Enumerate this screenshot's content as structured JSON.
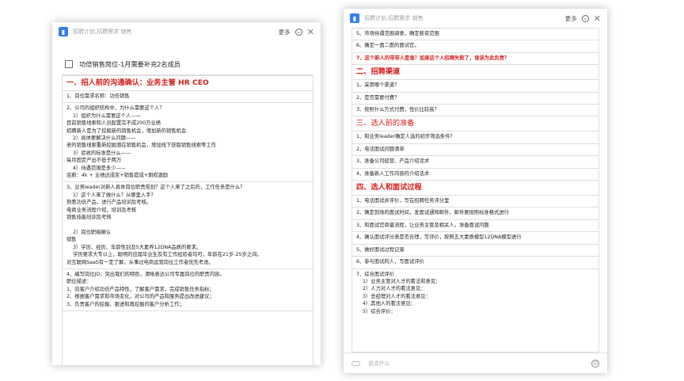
{
  "left": {
    "header": {
      "title": "招聘计划,招聘需求 销售",
      "more_label": "更多",
      "logo_char": "▮"
    },
    "todo": {
      "text": "功倍销售岗位-1月需要补充2名成员"
    },
    "doc": {
      "section1": "一、招人前的沟通确认：业务主管 HR CEO",
      "b1": [
        "1、岗位需求名称：功倍销售"
      ],
      "b2": [
        "2、公司的组织结构中，为什么需要这个人？",
        "1）组织为什么需要这个人——",
        "目前销售线索和人员配置完不成200万业绩",
        "招聘新人是为了挖掘新的销售机会，增加新的销售机会",
        "2）具体要解决什么问题——",
        "老的销售线索重新挖掘潜在销售机会，增加线下获取销售线索等工作",
        "3）验收的标准是什么——",
        "每月固定产出不低于两万",
        "4）待遇范围是多少——",
        "底薪：4k + 业绩达成奖+销售提成+期权激励"
      ],
      "b3": [
        "3、业务leader对新人具体岗位职责规划？这个人来了之后的，工作任务是什么？",
        "1）这个人来了做什么？从哪里入手？",
        "熟悉功倍产品，进行产品培训及考核。",
        "电商业务流程介绍，培训及考核",
        "销售技能培训及考核",
        "",
        "2）岗位职级确认",
        "销售",
        "3）学历、经历、年龄性别及5大素养12DNA品质的要求。",
        "学历要求大专以上，聪明的应届毕业生及有工作经验者均可，年龄在21岁-25岁之间。",
        "对互联网SaaS有一定了解，从事过电商运营岗位工作者优先考虑。"
      ],
      "b4": [
        "4、编写岗位JD，突出我们的特色，清晰表达公司专属岗位的职责内容。",
        "职位描述：",
        "1、向客户介绍功倍产品特性，了解客户需求，完成销售任务指标；",
        "2、根据客户需求和市场变化，对公司的产品和服务提出改进建议；",
        "3、负责客户的挖掘、跟进和再挖掘的客户分析工作；"
      ]
    }
  },
  "right": {
    "header": {
      "title": "招聘计划,招聘需求 销售",
      "more_label": "更多",
      "logo_char": "▮"
    },
    "doc": {
      "top": [
        "5、市场待遇范围调查，确定薪资范围",
        "6、确定一面二面的面试官。"
      ],
      "q7": "7、这个新人的带带人是谁？如果这个人招聘失败了，谁该为此负责？",
      "sec2": "二、招聘渠道",
      "s2": [
        "1、采用哪个渠道？",
        "2、是否需要付费？",
        "3、按照什么方式付费，性价比较高？"
      ],
      "sec3": "三、选人前的准备",
      "s3": [
        "1、和业务leader确定人选的初步筛选条件？",
        "2、电话面试问题清单",
        "3、准备公司经营、产品介绍话术",
        "4、准备新人工作内容的介绍话术"
      ],
      "sec4": "四、选人和面试过程",
      "s4": [
        "1、电话面试并评价，写在招聘任务评分里",
        "2、确定到场的面试时间，发面试通知邮件，邮件要按照标准格式进行",
        "3、和面试官商量流程，让业务主管及相关人，准备面试问题",
        "4、确认面试评分表是否合理，写评价，按照五大素质模型12DNA模型进行",
        "5、做好面试过程记录",
        "6、参与面试的人，写面试评价"
      ],
      "s4_7": [
        "7、综合面试评价",
        "1）业务主管对人才的看法和意见：",
        "2）人力对人才的看法意见：",
        "3）总经理对人才的看法意见：",
        "4）其他人的看法意见：",
        "5）综合评价："
      ]
    },
    "footer": {
      "placeholder": "说点什么"
    }
  }
}
